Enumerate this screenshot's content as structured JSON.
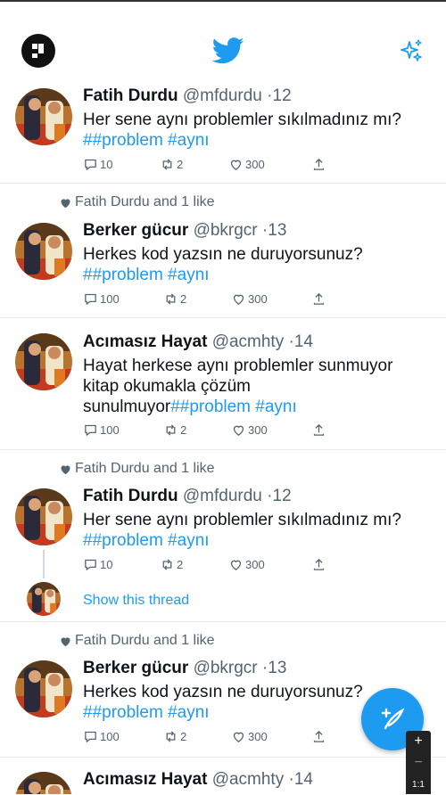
{
  "header": {
    "profile_icon": "profile-avatar-icon",
    "logo_icon": "twitter-bird-icon",
    "sparkle_icon": "sparkle-icon"
  },
  "tweets": [
    {
      "social": "",
      "name": "Fatih Durdu",
      "handle": "@mfdurdu",
      "time": "·12",
      "text": "Her sene aynı problemler sıkılmadınız mı?",
      "tags": "##problem #aynı",
      "replies": "10",
      "retweets": "2",
      "likes": "300"
    },
    {
      "social": "Fatih Durdu and 1 like",
      "name": "Berker gücur",
      "handle": "@bkrgcr",
      "time": "·13",
      "text": "Herkes kod yazsın ne duruyorsunuz?",
      "tags": "##problem #aynı",
      "replies": "100",
      "retweets": "2",
      "likes": "300"
    },
    {
      "social": "",
      "name": "Acımasız Hayat",
      "handle": "@acmhty",
      "time": "·14",
      "text_line1": "Hayat herkese aynı problemler sunmuyor",
      "text_line2": "kitap okumakla çözüm",
      "text_line3": "sunulmuyor",
      "tags": "##problem #aynı",
      "replies": "100",
      "retweets": "2",
      "likes": "300"
    },
    {
      "social": "Fatih Durdu and 1 like",
      "name": "Fatih Durdu",
      "handle": "@mfdurdu",
      "time": "·12",
      "text": "Her sene aynı problemler sıkılmadınız mı?",
      "tags": "##problem #aynı",
      "replies": "10",
      "retweets": "2",
      "likes": "300",
      "show_thread": "Show this thread"
    },
    {
      "social": "Fatih Durdu and 1 like",
      "name": "Berker gücur",
      "handle": "@bkrgcr",
      "time": "·13",
      "text": "Herkes kod yazsın ne duruyorsunuz?",
      "tags": "##problem #aynı",
      "replies": "100",
      "retweets": "2",
      "likes": "300"
    },
    {
      "social": "",
      "name": "Acımasız Hayat",
      "handle": "@acmhty",
      "time": "·14"
    }
  ],
  "zoom": {
    "plus": "+",
    "minus": "−",
    "ratio": "1:1"
  },
  "colors": {
    "accent": "#1d9bf0",
    "muted": "#536471",
    "border": "#e6ecf0"
  }
}
